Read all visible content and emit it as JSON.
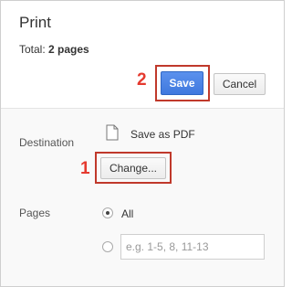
{
  "header": {
    "title": "Print",
    "total_label": "Total:",
    "total_value": "2 pages"
  },
  "annotations": {
    "step_change": "1",
    "step_save": "2",
    "highlight_color": "#c0392b"
  },
  "buttons": {
    "save": "Save",
    "cancel": "Cancel",
    "change": "Change..."
  },
  "destination": {
    "label": "Destination",
    "value": "Save as PDF",
    "icon": "document-icon"
  },
  "pages": {
    "label": "Pages",
    "options": [
      {
        "label": "All",
        "selected": true
      },
      {
        "label": "",
        "selected": false
      }
    ],
    "custom_placeholder": "e.g. 1-5, 8, 11-13"
  },
  "colors": {
    "accent": "#4a84e8",
    "annotation_red": "#e53a2f"
  }
}
